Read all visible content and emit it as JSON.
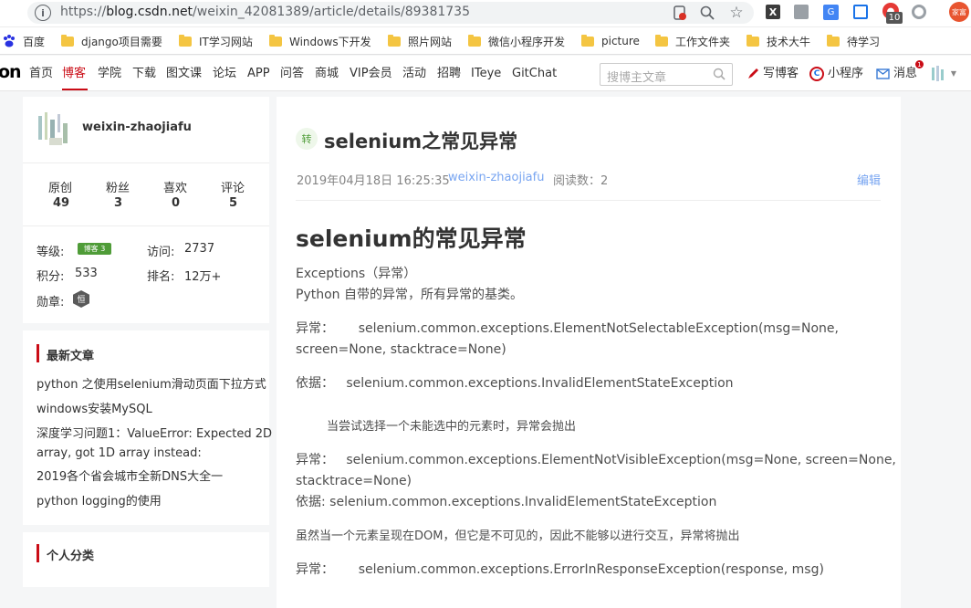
{
  "browser": {
    "url_prefix": "https://",
    "url_host": "blog.csdn.net",
    "url_path": "/weixin_42081389/article/details/89381735",
    "ext_badge": "10",
    "avatar_text": "家富"
  },
  "bookmarks": [
    "百度",
    "django项目需要",
    "IT学习网站",
    "Windows下开发",
    "照片网站",
    "微信小程序开发",
    "picture",
    "工作文件夹",
    "技术大牛",
    "待学习"
  ],
  "nav": {
    "logo_fragment": "on",
    "items": [
      "首页",
      "博客",
      "学院",
      "下载",
      "图文课",
      "论坛",
      "APP",
      "问答",
      "商城",
      "VIP会员",
      "活动",
      "招聘",
      "ITeye",
      "GitChat"
    ],
    "search_placeholder": "搜博主文章",
    "write": "写博客",
    "miniapp": "小程序",
    "messages": "消息",
    "msg_badge": "1"
  },
  "profile": {
    "username": "weixin-zhaojiafu",
    "stats": [
      {
        "label": "原创",
        "value": "49"
      },
      {
        "label": "粉丝",
        "value": "3"
      },
      {
        "label": "喜欢",
        "value": "0"
      },
      {
        "label": "评论",
        "value": "5"
      }
    ],
    "level_label": "等级:",
    "level_badge": "博客 3",
    "visits_label": "访问:",
    "visits": "2737",
    "points_label": "积分:",
    "points": "533",
    "rank_label": "排名:",
    "rank": "12万+",
    "medal_label": "勋章:",
    "medal_text": "恒"
  },
  "recent": {
    "title": "最新文章",
    "items": [
      "python 之使用selenium滑动页面下拉方式",
      "windows安装MySQL",
      "深度学习问题1：ValueError: Expected 2D",
      "array, got 1D array instead:",
      "2019各个省会城市全新DNS大全一",
      "python logging的使用"
    ]
  },
  "category": {
    "title": "个人分类"
  },
  "article": {
    "tag": "转",
    "title": "selenium之常见异常",
    "date": "2019年04月18日 16:25:35",
    "author": "weixin-zhaojiafu",
    "reads": "阅读数：2",
    "edit": "编辑",
    "h1": "selenium的常见异常",
    "p1a": "Exceptions（异常）",
    "p1b": "Python 自带的异常，所有异常的基类。",
    "p2a": "异常：      selenium.common.exceptions.ElementNotSelectableException(msg=None,",
    "p2b": "screen=None, stacktrace=None)",
    "p3": "依据：   selenium.common.exceptions.InvalidElementStateException",
    "p4": "当尝试选择一个未能选中的元素时，异常会抛出",
    "p5a": "异常：   selenium.common.exceptions.ElementNotVisibleException(msg=None, screen=None,",
    "p5b": "stacktrace=None)",
    "p5c": "依据: selenium.common.exceptions.InvalidElementStateException",
    "p6": "虽然当一个元素呈现在DOM，但它是不可见的，因此不能够以进行交互，异常将抛出",
    "p7": "异常：      selenium.common.exceptions.ErrorInResponseException(response, msg)"
  }
}
